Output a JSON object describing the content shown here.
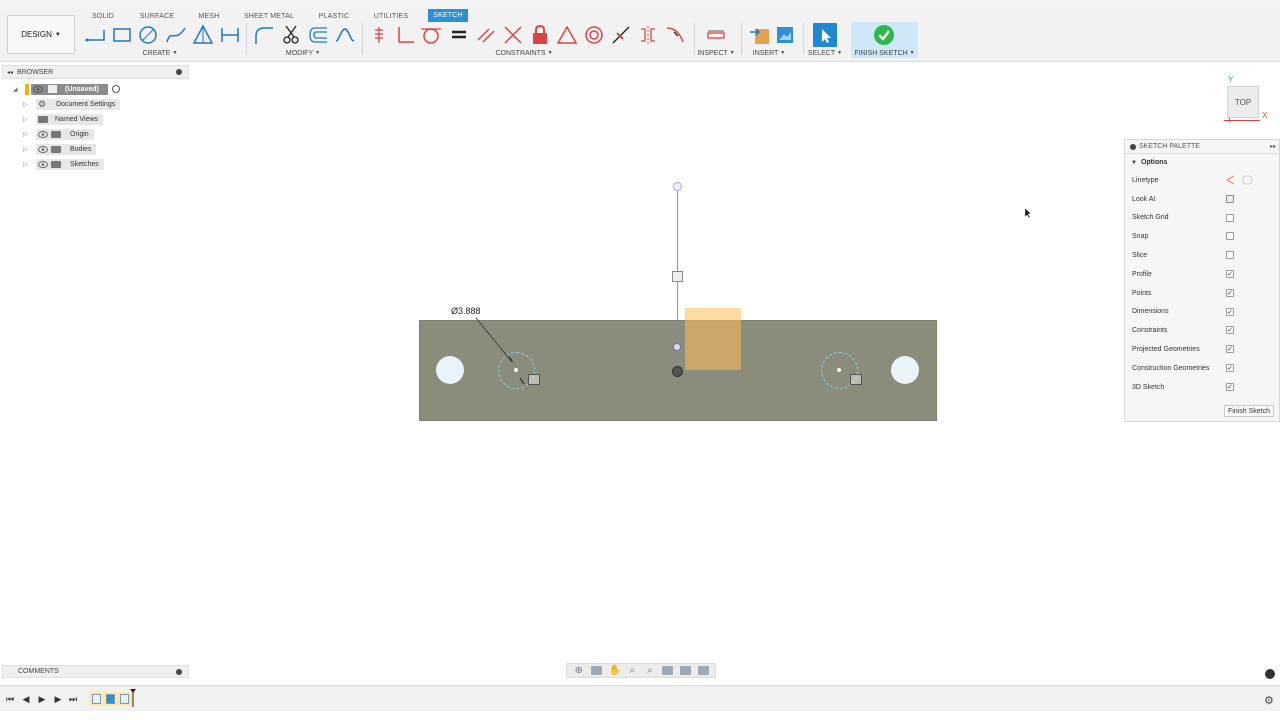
{
  "toolbar": {
    "design_label": "DESIGN",
    "tabs": [
      "SOLID",
      "SURFACE",
      "MESH",
      "SHEET METAL",
      "PLASTIC",
      "UTILITIES",
      "SKETCH"
    ],
    "active_tab": "SKETCH",
    "groups": {
      "create": "CREATE",
      "modify": "MODIFY",
      "constraints": "CONSTRAINTS",
      "inspect": "INSPECT",
      "insert": "INSERT",
      "select": "SELECT",
      "finish": "FINISH SKETCH"
    },
    "accent_color": "#2d8fd6"
  },
  "browser": {
    "title": "BROWSER",
    "items": [
      {
        "label": "(Unsaved)",
        "icon": "document-icon"
      },
      {
        "label": "Document Settings",
        "icon": "gear-icon"
      },
      {
        "label": "Named Views",
        "icon": "folder-icon"
      },
      {
        "label": "Origin",
        "icon": "folder-icon"
      },
      {
        "label": "Bodies",
        "icon": "folder-icon"
      },
      {
        "label": "Sketches",
        "icon": "folder-icon"
      }
    ]
  },
  "canvas": {
    "dimension_label": "Ø3.888",
    "view_cube_label": "TOP",
    "axis_y": "Y",
    "axis_x": "X"
  },
  "palette": {
    "title": "SKETCH PALETTE",
    "section": "Options",
    "rows": [
      {
        "label": "Linetype",
        "checked": null
      },
      {
        "label": "Look At",
        "checked": null
      },
      {
        "label": "Sketch Grid",
        "checked": false
      },
      {
        "label": "Snap",
        "checked": false
      },
      {
        "label": "Slice",
        "checked": false
      },
      {
        "label": "Profile",
        "checked": true
      },
      {
        "label": "Points",
        "checked": true
      },
      {
        "label": "Dimensions",
        "checked": true
      },
      {
        "label": "Constraints",
        "checked": true
      },
      {
        "label": "Projected Geometries",
        "checked": true
      },
      {
        "label": "Construction Geometries",
        "checked": true
      },
      {
        "label": "3D Sketch",
        "checked": true
      }
    ],
    "finish_button": "Finish Sketch"
  },
  "comments": {
    "title": "COMMENTS"
  }
}
